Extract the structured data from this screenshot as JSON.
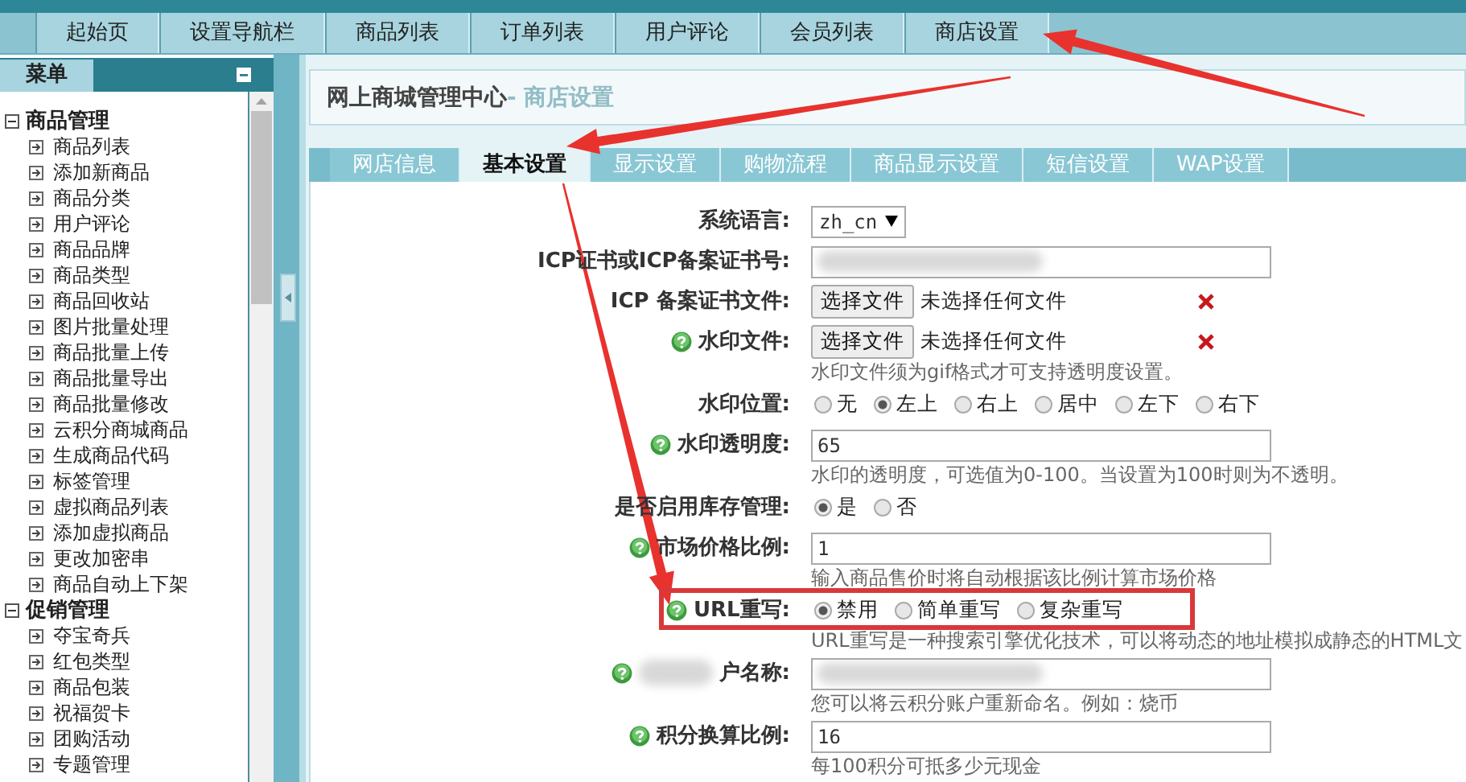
{
  "nav_tabs": [
    {
      "label": "起始页"
    },
    {
      "label": "设置导航栏"
    },
    {
      "label": "商品列表"
    },
    {
      "label": "订单列表"
    },
    {
      "label": "用户评论"
    },
    {
      "label": "会员列表"
    },
    {
      "label": "商店设置"
    }
  ],
  "sidebar": {
    "title": "菜单",
    "groups": [
      {
        "label": "商品管理",
        "expanded": true,
        "children": [
          "商品列表",
          "添加新商品",
          "商品分类",
          "用户评论",
          "商品品牌",
          "商品类型",
          "商品回收站",
          "图片批量处理",
          "商品批量上传",
          "商品批量导出",
          "商品批量修改",
          "云积分商城商品",
          "生成商品代码",
          "标签管理",
          "虚拟商品列表",
          "添加虚拟商品",
          "更改加密串",
          "商品自动上下架"
        ]
      },
      {
        "label": "促销管理",
        "expanded": true,
        "children": [
          "夺宝奇兵",
          "红包类型",
          "商品包装",
          "祝福贺卡",
          "团购活动",
          "专题管理"
        ]
      }
    ]
  },
  "page_title": {
    "main": "网上商城管理中心",
    "sub": "- 商店设置"
  },
  "tabs": [
    {
      "label": "网店信息",
      "selected": false
    },
    {
      "label": "基本设置",
      "selected": true
    },
    {
      "label": "显示设置",
      "selected": false
    },
    {
      "label": "购物流程",
      "selected": false
    },
    {
      "label": "商品显示设置",
      "selected": false
    },
    {
      "label": "短信设置",
      "selected": false
    },
    {
      "label": "WAP设置",
      "selected": false
    }
  ],
  "form": [
    {
      "kind": "select",
      "label": "系统语言:",
      "help": false,
      "value": "zh_cn"
    },
    {
      "kind": "text",
      "label": "ICP证书或ICP备案证书号:",
      "help": false,
      "blurred": true
    },
    {
      "kind": "file",
      "label": "ICP 备案证书文件:",
      "help": false,
      "button": "选择文件",
      "status": "未选择任何文件",
      "removable": true
    },
    {
      "kind": "file",
      "label": "水印文件:",
      "help": true,
      "button": "选择文件",
      "status": "未选择任何文件",
      "removable": true,
      "hint": "水印文件须为gif格式才可支持透明度设置。"
    },
    {
      "kind": "radio",
      "label": "水印位置:",
      "help": false,
      "options": [
        {
          "label": "无",
          "selected": false
        },
        {
          "label": "左上",
          "selected": true
        },
        {
          "label": "右上",
          "selected": false
        },
        {
          "label": "居中",
          "selected": false
        },
        {
          "label": "左下",
          "selected": false
        },
        {
          "label": "右下",
          "selected": false
        }
      ]
    },
    {
      "kind": "text",
      "label": "水印透明度:",
      "help": true,
      "value": "65",
      "hint": "水印的透明度，可选值为0-100。当设置为100时则为不透明。"
    },
    {
      "kind": "radio",
      "label": "是否启用库存管理:",
      "help": false,
      "options": [
        {
          "label": "是",
          "selected": true
        },
        {
          "label": "否",
          "selected": false
        }
      ]
    },
    {
      "kind": "text",
      "label": "市场价格比例:",
      "help": true,
      "value": "1",
      "hint": "输入商品售价时将自动根据该比例计算市场价格"
    },
    {
      "kind": "radio",
      "label": "URL重写:",
      "help": true,
      "options": [
        {
          "label": "禁用",
          "selected": true
        },
        {
          "label": "简单重写",
          "selected": false
        },
        {
          "label": "复杂重写",
          "selected": false
        }
      ],
      "hint": "URL重写是一种搜索引擎优化技术，可以将动态的地址模拟成静态的HTML文"
    },
    {
      "kind": "text",
      "label": "户名称:",
      "help": true,
      "label_blurred": true,
      "blurred": true,
      "hint": "您可以将云积分账户重新命名。例如：烧币"
    },
    {
      "kind": "text",
      "label": "积分换算比例:",
      "help": true,
      "value": "16",
      "hint": "每100积分可抵多少元现金"
    }
  ]
}
